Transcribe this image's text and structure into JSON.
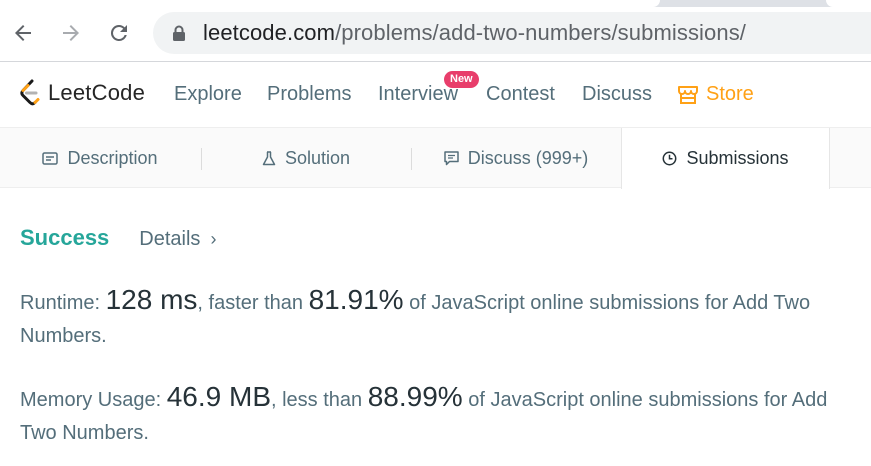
{
  "browser": {
    "url_host": "leetcode.com",
    "url_path": "/problems/add-two-numbers/submissions/"
  },
  "nav": {
    "logo_text": "LeetCode",
    "links": [
      "Explore",
      "Problems",
      "Interview",
      "Contest",
      "Discuss"
    ],
    "new_badge": "New",
    "store": "Store"
  },
  "tabs": {
    "description": "Description",
    "solution": "Solution",
    "discuss": "Discuss (999+)",
    "submissions": "Submissions"
  },
  "result": {
    "status": "Success",
    "details": "Details",
    "details_chevron": "›"
  },
  "runtime": {
    "label": "Runtime:",
    "value": "128 ms",
    "mid": ", faster than",
    "percent": "81.91%",
    "tail": "of JavaScript online submissions for Add Two Numbers."
  },
  "memory": {
    "label": "Memory Usage:",
    "value": "46.9 MB",
    "mid": ", less than",
    "percent": "88.99%",
    "tail": "of JavaScript online submissions for Add Two Numbers."
  },
  "colors": {
    "success": "#26a69a",
    "store": "#ffa116",
    "badge": "#e83e6b"
  }
}
